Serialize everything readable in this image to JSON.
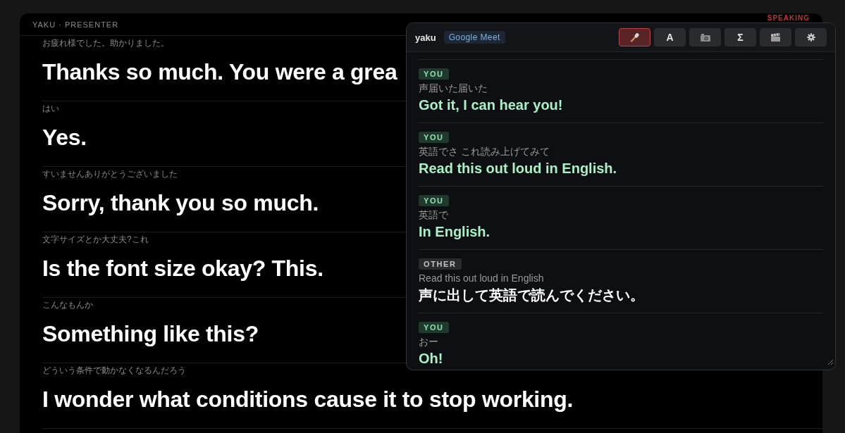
{
  "presenter": {
    "title": "YAKU · PRESENTER",
    "status": "SPEAKING",
    "rows": [
      {
        "source": "お疲れ様でした。助かりました。",
        "translation": "Thanks so much. You were a grea"
      },
      {
        "source": "はい",
        "translation": "Yes."
      },
      {
        "source": "すいませんありがとうございました",
        "translation": "Sorry, thank you so much."
      },
      {
        "source": "文字サイズとか大丈夫?これ",
        "translation": "Is the font size okay? This."
      },
      {
        "source": "こんなもんか",
        "translation": "Something like this?"
      },
      {
        "source": "どういう条件で動かなくなるんだろう",
        "translation": "I wonder what conditions cause it to stop working."
      }
    ]
  },
  "overlay": {
    "app_name": "yaku",
    "source_badge": "Google Meet",
    "tools": [
      {
        "kind": "mic",
        "selected": true
      },
      {
        "kind": "text",
        "label": "A",
        "selected": false
      },
      {
        "kind": "camera",
        "selected": false
      },
      {
        "kind": "text",
        "label": "Σ",
        "selected": false
      },
      {
        "kind": "clapper",
        "selected": false
      },
      {
        "kind": "gear",
        "selected": false
      }
    ],
    "messages": [
      {
        "kind": "you",
        "speaker": "YOU",
        "source": "声届いた届いた",
        "translation": "Got it, I can hear you!"
      },
      {
        "kind": "you",
        "speaker": "YOU",
        "source": "英語でさ これ読み上げてみて",
        "translation": "Read this out loud in English."
      },
      {
        "kind": "you",
        "speaker": "YOU",
        "source": "英語で",
        "translation": "In English."
      },
      {
        "kind": "other",
        "speaker": "OTHER",
        "source": "Read this out loud in English",
        "translation": "声に出して英語で読んでください。"
      },
      {
        "kind": "you",
        "speaker": "YOU",
        "source": "おー",
        "translation": "Oh!"
      }
    ]
  }
}
